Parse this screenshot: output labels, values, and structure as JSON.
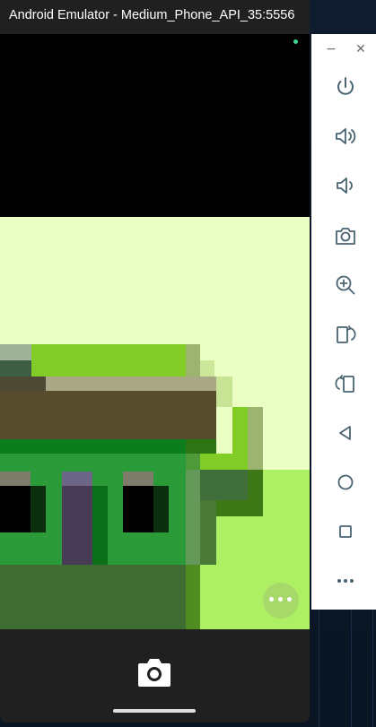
{
  "window": {
    "title": "Android Emulator - Medium_Phone_API_35:5556"
  },
  "toolbar": {
    "minimize_label": "−",
    "close_label": "✕",
    "buttons": [
      {
        "name": "power-icon"
      },
      {
        "name": "volume-up-icon"
      },
      {
        "name": "volume-down-icon"
      },
      {
        "name": "screenshot-camera-icon"
      },
      {
        "name": "zoom-icon"
      },
      {
        "name": "rotate-left-icon"
      },
      {
        "name": "rotate-right-icon"
      },
      {
        "name": "back-icon"
      },
      {
        "name": "home-icon"
      },
      {
        "name": "overview-icon"
      },
      {
        "name": "more-icon"
      }
    ]
  },
  "screen": {
    "more_button_label": "•••",
    "accent_color": "#a6d86a",
    "status_dot_color": "#3dd68c"
  },
  "nav": {
    "camera_icon": "camera-icon"
  }
}
